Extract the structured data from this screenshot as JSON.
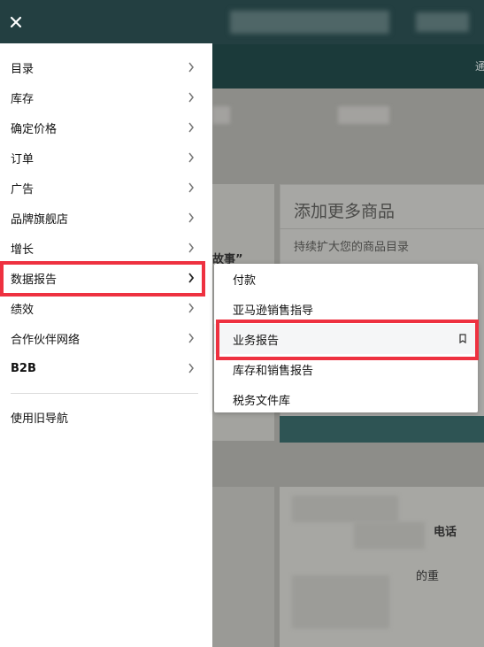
{
  "colors": {
    "header_bg": "#233f41",
    "highlight": "#ee3140",
    "drawer_bg": "#ffffff",
    "text": "#111111"
  },
  "drawer": {
    "close_icon": "close-icon",
    "items": [
      {
        "label": "目录",
        "has_children": true
      },
      {
        "label": "库存",
        "has_children": true
      },
      {
        "label": "确定价格",
        "has_children": true
      },
      {
        "label": "订单",
        "has_children": true
      },
      {
        "label": "广告",
        "has_children": true
      },
      {
        "label": "品牌旗舰店",
        "has_children": true
      },
      {
        "label": "增长",
        "has_children": true
      },
      {
        "label": "数据报告",
        "has_children": true,
        "expanded": true
      },
      {
        "label": "绩效",
        "has_children": true
      },
      {
        "label": "合作伙伴网络",
        "has_children": true
      },
      {
        "label": "B2B",
        "has_children": true
      }
    ],
    "legacy_nav_label": "使用旧导航"
  },
  "submenu": {
    "parent": "数据报告",
    "items": [
      {
        "label": "付款"
      },
      {
        "label": "亚马逊销售指导"
      },
      {
        "label": "业务报告",
        "active": true,
        "bookmark_icon": "bookmark-icon"
      },
      {
        "label": "库存和销售报告"
      },
      {
        "label": "税务文件库"
      }
    ]
  },
  "background": {
    "card_title": "添加更多商品",
    "card_subtitle": "持续扩大您的商品目录",
    "snippet1": "故事”",
    "snippet2": "电话",
    "snippet3": "的重",
    "corner_text": "通"
  }
}
